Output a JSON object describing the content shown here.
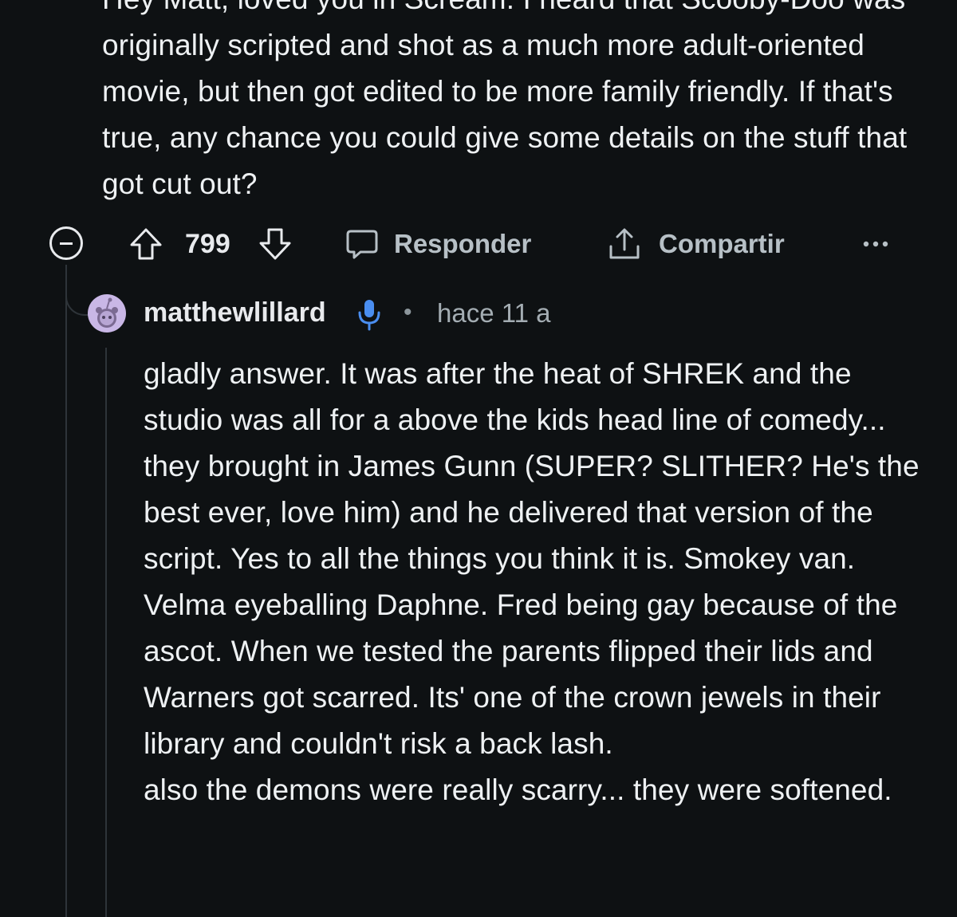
{
  "parent_comment": {
    "body": "Hey Matt, loved you in Scream. I heard that Scooby-Doo was originally scripted and shot as a much more adult-oriented movie, but then got edited to be more family friendly. If that's true, any chance you could give some details on the stuff that got cut out?",
    "score": "799",
    "reply_label": "Responder",
    "share_label": "Compartir"
  },
  "reply_comment": {
    "author": "matthewlillard",
    "separator": "•",
    "timestamp": "hace 11 a",
    "paragraphs": [
      "gladly answer. It was after the heat of SHREK and the studio was all for a above the kids head line of comedy... they brought in James Gunn (SUPER? SLITHER? He's the best ever, love him) and he delivered that version of the script. Yes to all the things you think it is. Smokey van. Velma eyeballing Daphne. Fred being gay because of the ascot. When we tested the parents flipped their lids and Warners got scarred. Its' one of the crown jewels in their library and couldn't risk a back lash.",
      "also the demons were really scarry... they were softened."
    ]
  },
  "icons": {
    "collapse": "minus-circle-icon",
    "upvote": "arrow-up-icon",
    "downvote": "arrow-down-icon",
    "reply": "chat-bubble-icon",
    "share": "share-icon",
    "more": "ellipsis-icon",
    "verified": "microphone-icon",
    "avatar": "snoo-avatar"
  },
  "colors": {
    "background": "#0e1113",
    "text": "#eef1f3",
    "muted": "#b7c0c6",
    "thread_line": "#2e3439",
    "avatar_bg": "#c9b7e6",
    "mic_blue": "#4a8ef0"
  }
}
